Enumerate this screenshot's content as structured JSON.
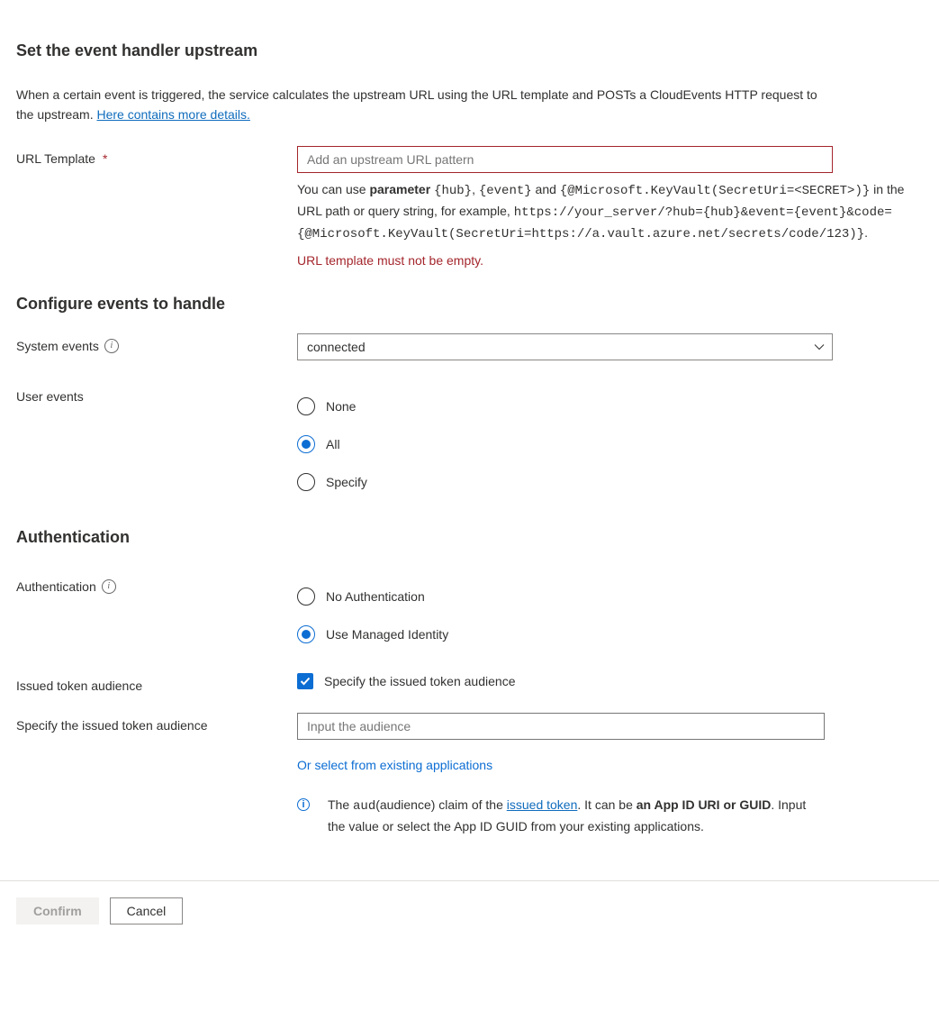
{
  "title": "Set the event handler upstream",
  "intro_before_link": "When a certain event is triggered, the service calculates the upstream URL using the URL template and POSTs a CloudEvents HTTP request to the upstream. ",
  "intro_link": "Here contains more details.",
  "urlTemplate": {
    "label": "URL Template",
    "required_marker": "*",
    "placeholder": "Add an upstream URL pattern",
    "value": "",
    "help_pre": "You can use ",
    "help_bold": "parameter ",
    "help_mono1": "{hub}",
    "help_mid1": ", ",
    "help_mono2": "{event}",
    "help_mid2": " and ",
    "help_mono3": "{@Microsoft.KeyVault(SecretUri=<SECRET>)}",
    "help_mid3": " in the URL path or query string, for example, ",
    "help_mono4": "https://your_server/?hub={hub}&event={event}&code={@Microsoft.KeyVault(SecretUri=https://a.vault.azure.net/secrets/code/123)}",
    "help_tail": ".",
    "error": "URL template must not be empty."
  },
  "events": {
    "heading": "Configure events to handle",
    "system_label": "System events",
    "system_value": "connected",
    "user_label": "User events",
    "user_options": {
      "none": "None",
      "all": "All",
      "specify": "Specify"
    },
    "user_selected": "all"
  },
  "auth": {
    "heading": "Authentication",
    "label": "Authentication",
    "options": {
      "none": "No Authentication",
      "managed": "Use Managed Identity"
    },
    "selected": "managed",
    "issued_label": "Issued token audience",
    "checkbox_label": "Specify the issued token audience",
    "checkbox_checked": true,
    "audience_label": "Specify the issued token audience",
    "audience_placeholder": "Input the audience",
    "audience_value": "",
    "select_link": "Or select from existing applications",
    "note_pre": "The ",
    "note_mono": "aud",
    "note_mid1": "(audience) claim of the ",
    "note_link": "issued token",
    "note_mid2": ". It can be ",
    "note_bold": "an App ID URI or GUID",
    "note_tail": ". Input the value or select the App ID GUID from your existing applications."
  },
  "footer": {
    "confirm": "Confirm",
    "cancel": "Cancel"
  }
}
